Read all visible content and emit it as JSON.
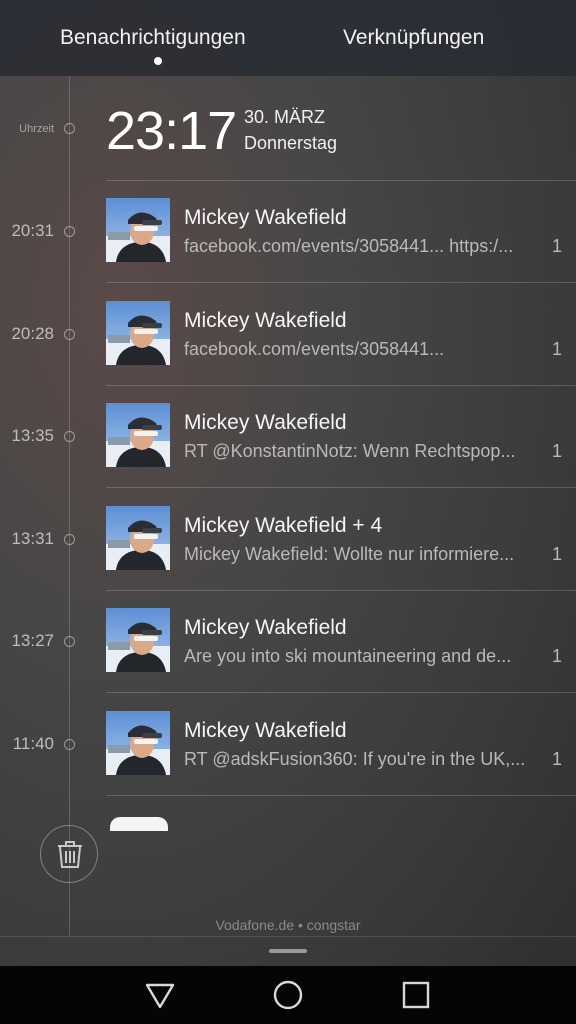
{
  "tabs": [
    {
      "label": "Benachrichtigungen",
      "active": true
    },
    {
      "label": "Verknüpfungen",
      "active": false
    }
  ],
  "header": {
    "label": "Uhrzeit",
    "time": "23:17",
    "date": "30. MÄRZ",
    "weekday": "Donnerstag"
  },
  "notifications": [
    {
      "time": "20:31",
      "sender": "Mickey Wakefield",
      "preview": "facebook.com/events/3058441... https:/...",
      "count": "1"
    },
    {
      "time": "20:28",
      "sender": "Mickey Wakefield",
      "preview": "facebook.com/events/3058441...",
      "count": "1"
    },
    {
      "time": "13:35",
      "sender": "Mickey Wakefield",
      "preview": "RT @KonstantinNotz: Wenn Rechtspop...",
      "count": "1"
    },
    {
      "time": "13:31",
      "sender": "Mickey Wakefield + 4",
      "preview": "Mickey Wakefield: Wollte nur informiere...",
      "count": "1"
    },
    {
      "time": "13:27",
      "sender": "Mickey Wakefield",
      "preview": "Are you into ski mountaineering and de...",
      "count": "1"
    },
    {
      "time": "11:40",
      "sender": "Mickey Wakefield",
      "preview": "RT @adskFusion360: If you're in the UK,...",
      "count": "1"
    }
  ],
  "footer": {
    "carrier": "Vodafone.de • congstar"
  },
  "icons": {
    "clear": "trash-icon",
    "back": "triangle-back-icon",
    "home": "circle-home-icon",
    "recents": "square-recents-icon"
  }
}
